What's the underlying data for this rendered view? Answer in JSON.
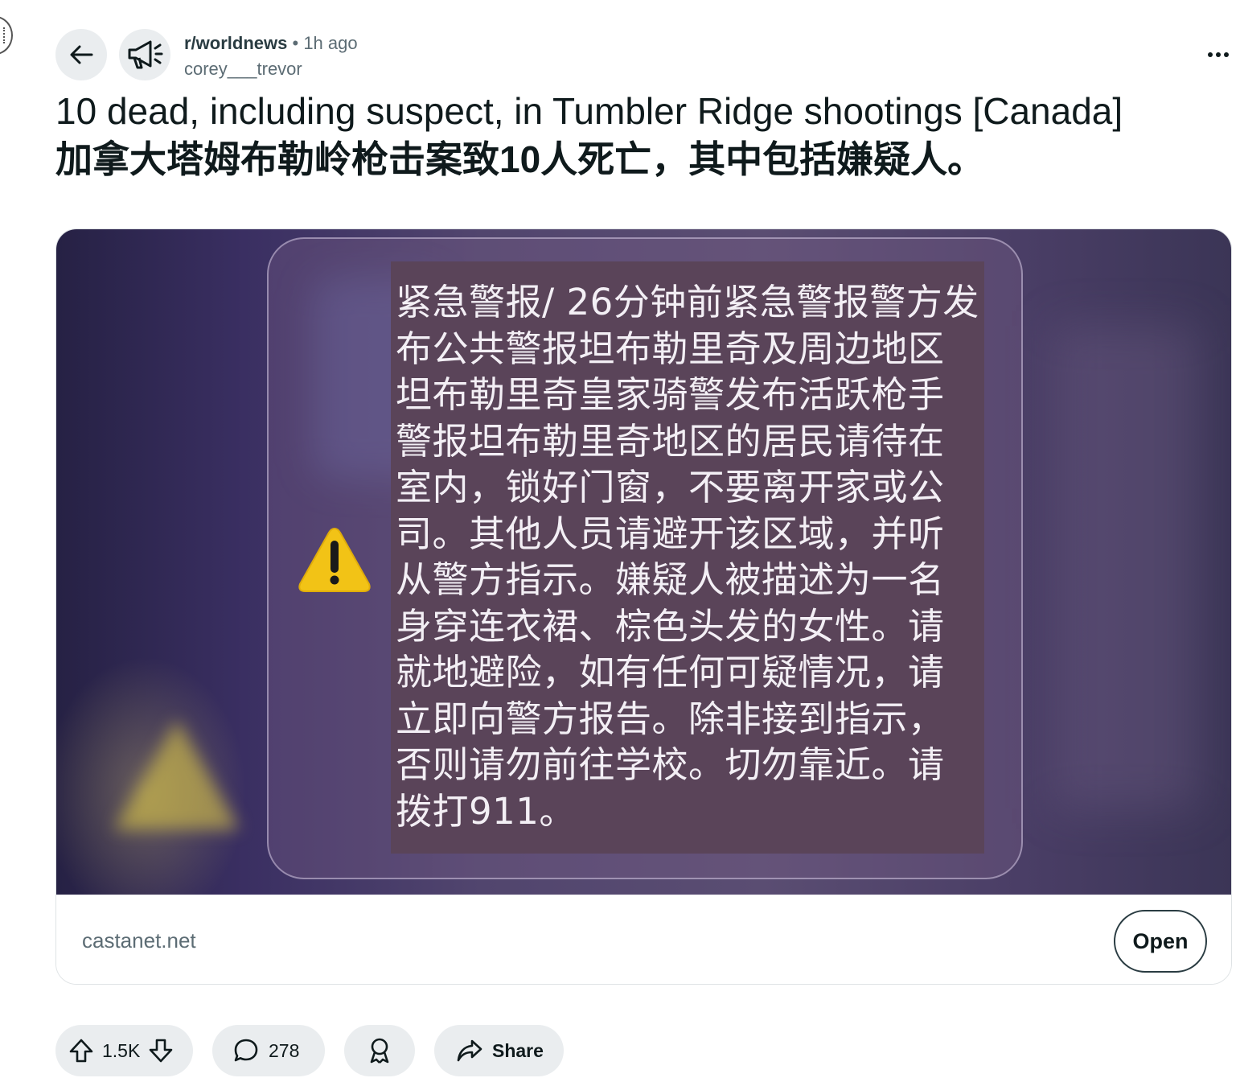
{
  "post": {
    "subreddit": "r/worldnews",
    "separator": "•",
    "time": "1h ago",
    "author": "corey___trevor",
    "title_en": "10 dead, including suspect, in Tumbler Ridge shootings [Canada]",
    "title_zh": "加拿大塔姆布勒岭枪击案致10人死亡，其中包括嫌疑人。"
  },
  "image": {
    "alert_text": "紧急警报/ 26分钟前紧急警报警方发布公共警报坦布勒里奇及周边地区坦布勒里奇皇家骑警发布活跃枪手警报坦布勒里奇地区的居民请待在室内，锁好门窗，不要离开家或公司。其他人员请避开该区域，并听从警方指示。嫌疑人被描述为一名身穿连衣裙、棕色头发的女性。请就地避险，如有任何可疑情况，请立即向警方报告。除非接到指示，否则请勿前往学校。切勿靠近。请拨打911。"
  },
  "link": {
    "domain": "castanet.net",
    "open_label": "Open"
  },
  "actions": {
    "upvotes": "1.5K",
    "comments": "278",
    "share_label": "Share"
  },
  "icons": {
    "back": "arrow-left-icon",
    "avatar": "megaphone-icon",
    "more": "ellipsis-icon",
    "warning": "warning-triangle-icon",
    "upvote": "arrow-up-icon",
    "downvote": "arrow-down-icon",
    "comment": "speech-bubble-icon",
    "award": "award-icon",
    "share": "share-arrow-icon"
  },
  "colors": {
    "button_bg": "#eaedef",
    "text": "#0f1a1c",
    "muted": "#5c6c74",
    "warning_yellow": "#f2c316"
  }
}
